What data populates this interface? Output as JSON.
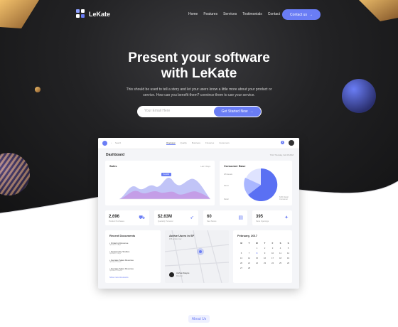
{
  "brand": {
    "name": "LeKate",
    "accent": "#6a7df5",
    "logo_icon": "four-square-logo-icon"
  },
  "nav": {
    "items": [
      "Home",
      "Features",
      "Services",
      "Testimonials",
      "Contact"
    ],
    "cta_label": "Contact us",
    "cta_icon": "arrow-right-icon"
  },
  "hero": {
    "title_line1": "Present your software",
    "title_line2": "with LeKate",
    "subtitle_line1": "This should be used to tell a story and let your users know a little more about your product or",
    "subtitle_line2": "service. How can you benefit them? convince them to use your service.",
    "email_placeholder": "Your Email Here",
    "submit_label": "Get Started Now"
  },
  "dashboard": {
    "search_placeholder": "Search",
    "tabs": [
      "Overview",
      "Quality",
      "Business",
      "Finances",
      "Customers"
    ],
    "notif_count": "3",
    "heading": "Dashboard",
    "date": "Third Thursday, Feb 08 2018",
    "sales": {
      "title": "Sales",
      "range": "Last 6 Days",
      "tooltip": "$1,203"
    },
    "consumer": {
      "title": "Consumer Base",
      "legend": [
        "Wholesale",
        "Direct",
        "Retail"
      ],
      "share": "64% Retail Consumer"
    },
    "stats": [
      {
        "value": "2,696",
        "label": "Product Purchases"
      },
      {
        "value": "$2.63M",
        "label": "Quarterly Turnover"
      },
      {
        "value": "60",
        "label": "New Stores"
      },
      {
        "value": "395",
        "label": "Store Openings"
      }
    ],
    "documents": {
      "title": "Recent Documents",
      "items": [
        {
          "name": "Ordering Revenue",
          "date": "Updated 3 days"
        },
        {
          "name": "Opportunity Studies",
          "date": "Updated 5 days"
        },
        {
          "name": "Average Sales Revenue",
          "date": "Updated 1 week"
        },
        {
          "name": "Average Sales Revenue",
          "date": "Updated 2 weeks"
        }
      ],
      "more": "Show more documents"
    },
    "map": {
      "title": "Active Users in SF",
      "subtitle": "156 active now",
      "user_name": "Joshua Dwayne",
      "user_role": "Director"
    },
    "calendar": {
      "title": "February, 2017",
      "weekdays": [
        "M",
        "T",
        "W",
        "T",
        "F",
        "S",
        "S"
      ],
      "days": [
        "",
        "",
        "1",
        "2",
        "3",
        "4",
        "5",
        "6",
        "7",
        "8",
        "9",
        "10",
        "11",
        "12",
        "13",
        "14",
        "15",
        "16",
        "17",
        "18",
        "19",
        "20",
        "21",
        "22",
        "23",
        "24",
        "25",
        "26",
        "27",
        "28",
        "",
        "",
        "",
        "",
        ""
      ]
    }
  },
  "section": {
    "about_label": "About Us"
  }
}
